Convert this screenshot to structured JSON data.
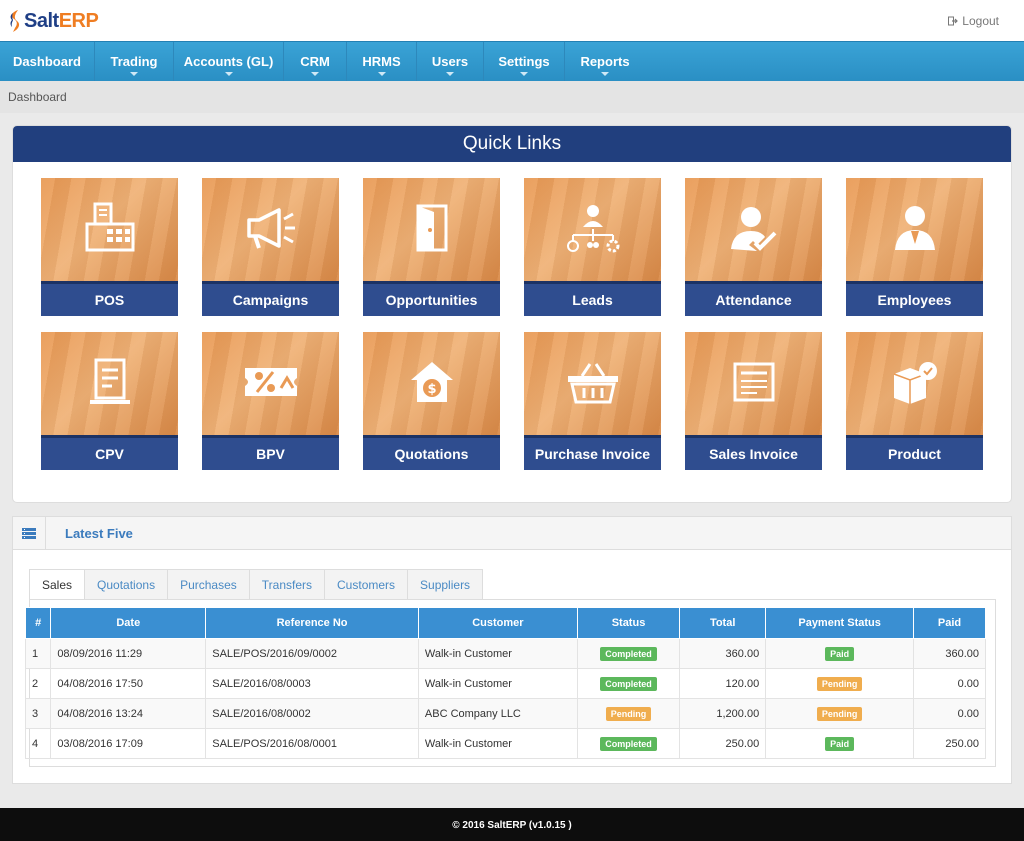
{
  "brand": {
    "name_part1": "Salt",
    "name_part2": "ERP"
  },
  "header": {
    "logout_label": "Logout"
  },
  "nav": [
    {
      "label": "Dashboard",
      "has_caret": false
    },
    {
      "label": "Trading",
      "has_caret": true
    },
    {
      "label": "Accounts (GL)",
      "has_caret": true
    },
    {
      "label": "CRM",
      "has_caret": true
    },
    {
      "label": "HRMS",
      "has_caret": true
    },
    {
      "label": "Users",
      "has_caret": true
    },
    {
      "label": "Settings",
      "has_caret": true
    },
    {
      "label": "Reports",
      "has_caret": true
    }
  ],
  "breadcrumb": "Dashboard",
  "quick_links": {
    "title": "Quick Links",
    "tiles": [
      {
        "label": "POS",
        "icon": "cash-register-icon"
      },
      {
        "label": "Campaigns",
        "icon": "megaphone-icon"
      },
      {
        "label": "Opportunities",
        "icon": "open-door-icon"
      },
      {
        "label": "Leads",
        "icon": "org-chart-icon"
      },
      {
        "label": "Attendance",
        "icon": "user-check-icon"
      },
      {
        "label": "Employees",
        "icon": "employee-icon"
      },
      {
        "label": "CPV",
        "icon": "receipt-icon"
      },
      {
        "label": "BPV",
        "icon": "percent-ticket-icon"
      },
      {
        "label": "Quotations",
        "icon": "house-dollar-icon"
      },
      {
        "label": "Purchase Invoice",
        "icon": "basket-icon"
      },
      {
        "label": "Sales Invoice",
        "icon": "invoice-icon"
      },
      {
        "label": "Product",
        "icon": "product-box-icon"
      }
    ]
  },
  "latest": {
    "title": "Latest Five",
    "tabs": [
      "Sales",
      "Quotations",
      "Purchases",
      "Transfers",
      "Customers",
      "Suppliers"
    ],
    "active_tab": "Sales",
    "columns": [
      "#",
      "Date",
      "Reference No",
      "Customer",
      "Status",
      "Total",
      "Payment Status",
      "Paid"
    ],
    "rows": [
      {
        "num": "1",
        "date": "08/09/2016 11:29",
        "ref": "SALE/POS/2016/09/0002",
        "customer": "Walk-in Customer",
        "status": "Completed",
        "total": "360.00",
        "payment": "Paid",
        "paid": "360.00"
      },
      {
        "num": "2",
        "date": "04/08/2016 17:50",
        "ref": "SALE/2016/08/0003",
        "customer": "Walk-in Customer",
        "status": "Completed",
        "total": "120.00",
        "payment": "Pending",
        "paid": "0.00"
      },
      {
        "num": "3",
        "date": "04/08/2016 13:24",
        "ref": "SALE/2016/08/0002",
        "customer": "ABC Company LLC",
        "status": "Pending",
        "total": "1,200.00",
        "payment": "Pending",
        "paid": "0.00"
      },
      {
        "num": "4",
        "date": "03/08/2016 17:09",
        "ref": "SALE/POS/2016/08/0001",
        "customer": "Walk-in Customer",
        "status": "Completed",
        "total": "250.00",
        "payment": "Paid",
        "paid": "250.00"
      }
    ]
  },
  "footer": "© 2016 SaltERP (v1.0.15 )",
  "colors": {
    "nav_blue": "#2a8fc4",
    "quick_links_header": "#213f7e",
    "tile_label": "#2f4d8f",
    "tile_photo": "#e99a55",
    "table_header": "#3a8fd2",
    "status_completed": "#5cb85c",
    "status_pending": "#f0ad4e"
  }
}
